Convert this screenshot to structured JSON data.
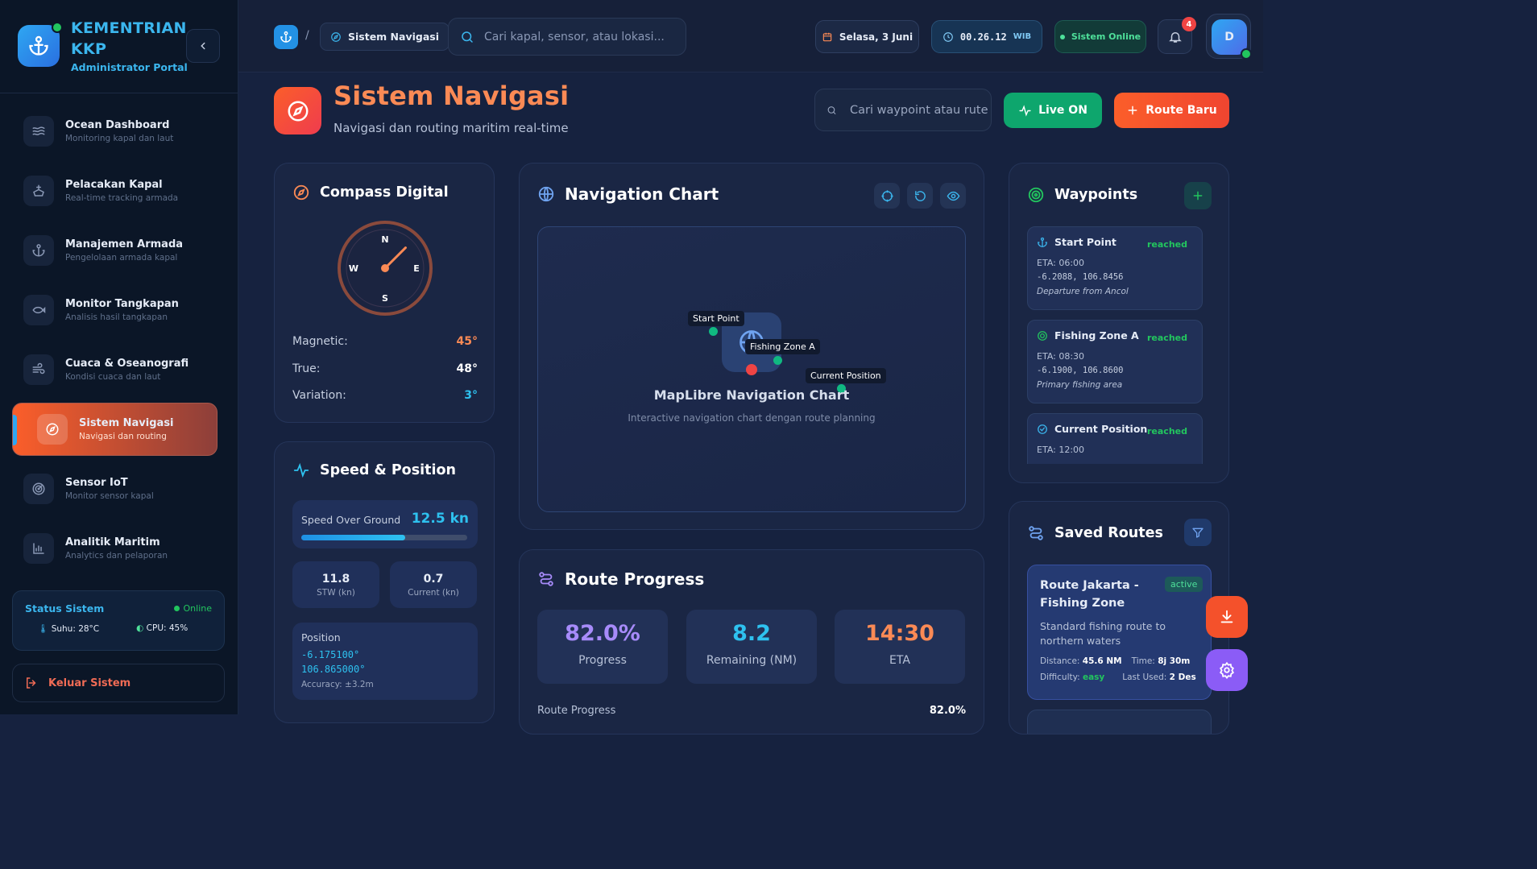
{
  "brand": {
    "title_line1": "KEMENTRIAN",
    "title_line2": "KKP",
    "subtitle": "Administrator Portal"
  },
  "sidebar": {
    "items": [
      {
        "label": "Ocean Dashboard",
        "sub": "Monitoring kapal dan laut",
        "icon": "waves-icon"
      },
      {
        "label": "Pelacakan Kapal",
        "sub": "Real-time tracking armada",
        "icon": "ship-icon"
      },
      {
        "label": "Manajemen Armada",
        "sub": "Pengelolaan armada kapal",
        "icon": "anchor-icon"
      },
      {
        "label": "Monitor Tangkapan",
        "sub": "Analisis hasil tangkapan",
        "icon": "fish-icon"
      },
      {
        "label": "Cuaca & Oseanografi",
        "sub": "Kondisi cuaca dan laut",
        "icon": "wind-icon"
      },
      {
        "label": "Sistem Navigasi",
        "sub": "Navigasi dan routing",
        "icon": "compass-icon",
        "active": true
      },
      {
        "label": "Sensor IoT",
        "sub": "Monitor sensor kapal",
        "icon": "radar-icon"
      },
      {
        "label": "Analitik Maritim",
        "sub": "Analytics dan pelaporan",
        "icon": "bar-chart-icon"
      }
    ],
    "status": {
      "title": "Status Sistem",
      "state": "Online",
      "temp": "Suhu: 28°C",
      "cpu": "CPU: 45%"
    },
    "logout": "Keluar Sistem"
  },
  "topbar": {
    "breadcrumb_sep": "/",
    "breadcrumb": "Sistem Navigasi",
    "search_placeholder": "Cari kapal, sensor, atau lokasi...",
    "date": "Selasa, 3 Juni",
    "time": "00.26.12",
    "timezone": "WIB",
    "system_status": "Sistem Online",
    "notifications": "4",
    "avatar_initial": "D"
  },
  "header": {
    "title": "Sistem Navigasi",
    "subtitle": "Navigasi dan routing maritim real-time",
    "search_placeholder": "Cari waypoint atau rute",
    "live_label": "Live ON",
    "new_route_label": "Route Baru"
  },
  "compass": {
    "title": "Compass Digital",
    "heading_deg": 45,
    "dirs": {
      "n": "N",
      "e": "E",
      "s": "S",
      "w": "W"
    },
    "rows": [
      {
        "label": "Magnetic:",
        "value": "45°",
        "color": "#fb8a55"
      },
      {
        "label": "True:",
        "value": "48°",
        "color": "#ffffff"
      },
      {
        "label": "Variation:",
        "value": "3°",
        "color": "#2ec1ef"
      }
    ]
  },
  "speed": {
    "title": "Speed & Position",
    "sog_label": "Speed Over Ground",
    "sog_value": "12.5 kn",
    "sog_fraction": 0.625,
    "stw_value": "11.8",
    "stw_label": "STW (kn)",
    "current_value": "0.7",
    "current_label": "Current (kn)",
    "position_label": "Position",
    "lat": "-6.175100°",
    "lon": "106.865000°",
    "accuracy": "Accuracy: ±3.2m"
  },
  "nav_chart": {
    "title": "Navigation Chart",
    "map_title": "MapLibre Navigation Chart",
    "map_subtitle": "Interactive navigation chart dengan route planning",
    "markers": {
      "start": "Start Point",
      "zone": "Fishing Zone A",
      "current": "Current Position"
    }
  },
  "route_progress": {
    "title": "Route Progress",
    "progress_value": "82.0%",
    "progress_label": "Progress",
    "remaining_value": "8.2",
    "remaining_label": "Remaining (NM)",
    "eta_value": "14:30",
    "eta_label": "ETA",
    "bar_label": "Route Progress",
    "bar_value": "82.0%"
  },
  "waypoints": {
    "title": "Waypoints",
    "items": [
      {
        "name": "Start Point",
        "status": "reached",
        "eta": "ETA: 06:00",
        "coords": "-6.2088, 106.8456",
        "desc": "Departure from Ancol",
        "icon": "anchor-icon"
      },
      {
        "name": "Fishing Zone A",
        "status": "reached",
        "eta": "ETA: 08:30",
        "coords": "-6.1900, 106.8600",
        "desc": "Primary fishing area",
        "icon": "target-icon"
      },
      {
        "name": "Current Position",
        "status": "reached",
        "eta": "ETA: 12:00",
        "coords": "",
        "desc": "",
        "icon": "check-circle-icon"
      }
    ]
  },
  "saved_routes": {
    "title": "Saved Routes",
    "route": {
      "name": "Route Jakarta - Fishing Zone",
      "status": "active",
      "desc": "Standard fishing route to northern waters",
      "distance_label": "Distance:",
      "distance": "45.6 NM",
      "time_label": "Time:",
      "time": "8j 30m",
      "difficulty_label": "Difficulty:",
      "difficulty": "easy",
      "last_used_label": "Last Used:",
      "last_used": "2 Des"
    }
  },
  "colors": {
    "accent": "#fb5e2a",
    "primary": "#2ea7f2",
    "success": "#22c55e",
    "live": "#0ea66d",
    "purple": "#8b5cf6"
  }
}
